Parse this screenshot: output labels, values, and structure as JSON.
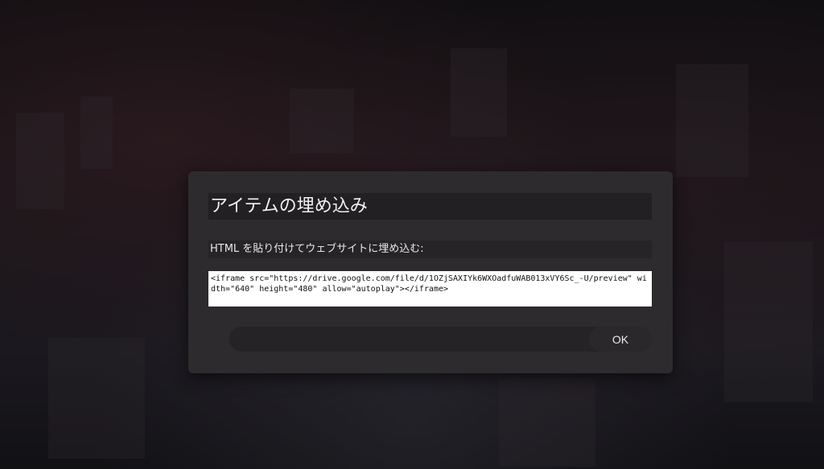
{
  "dialog": {
    "title": "アイテムの埋め込み",
    "label": "HTML を貼り付けてウェブサイトに埋め込む:",
    "embed_code": "<iframe src=\"https://drive.google.com/file/d/1OZjSAXIYk6WXOadfuWAB013xVY6Sc_-U/preview\" width=\"640\" height=\"480\" allow=\"autoplay\"></iframe>",
    "ok_label": "OK"
  },
  "colors": {
    "dialog_background": "#2d2b2d",
    "title_background": "#222022",
    "input_background": "#ffffff"
  }
}
